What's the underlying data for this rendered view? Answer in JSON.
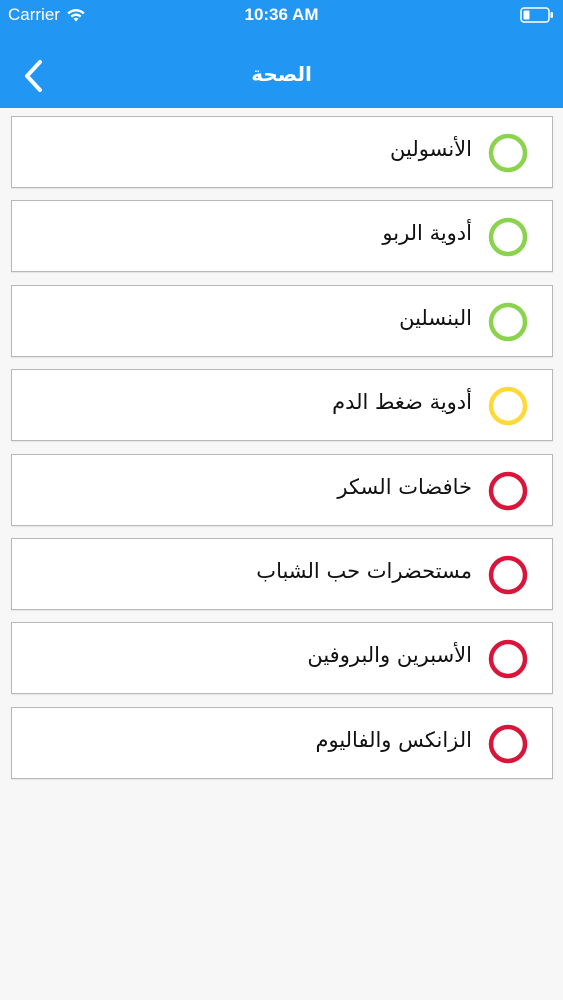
{
  "status_bar": {
    "carrier": "Carrier",
    "time": "10:36 AM",
    "wifi_icon": "wifi-icon",
    "battery_icon": "battery-icon"
  },
  "nav": {
    "title": "الصحة",
    "back_icon": "chevron-left-icon"
  },
  "colors": {
    "header": "#2196f3",
    "green": "#8bd34f",
    "yellow": "#ffd83a",
    "red": "#d8163b"
  },
  "items": [
    {
      "label": "الأنسولين",
      "status": "green"
    },
    {
      "label": "أدوية الربو",
      "status": "green"
    },
    {
      "label": "البنسلين",
      "status": "green"
    },
    {
      "label": "أدوية ضغط الدم",
      "status": "yellow"
    },
    {
      "label": "خافضات السكر",
      "status": "red"
    },
    {
      "label": "مستحضرات حب الشباب",
      "status": "red"
    },
    {
      "label": "الأسبرين والبروفين",
      "status": "red"
    },
    {
      "label": "الزانكس والفاليوم",
      "status": "red"
    }
  ]
}
